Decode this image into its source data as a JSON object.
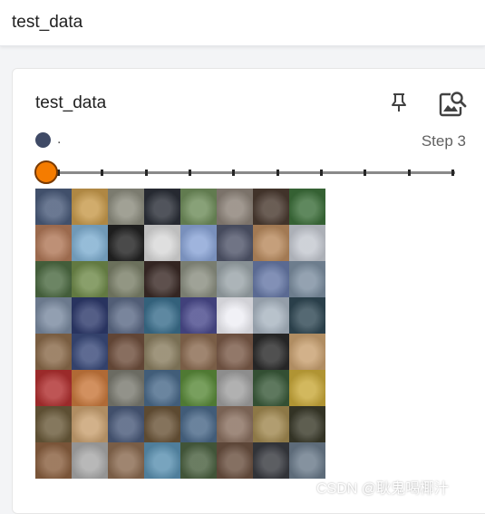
{
  "header": {
    "title": "test_data"
  },
  "card": {
    "title": "test_data",
    "pin_icon": "pin-icon",
    "image_search_icon": "image-search-icon",
    "run_label": ".",
    "run_color": "#3f4a66",
    "step_label": "Step 3",
    "slider": {
      "value": 0,
      "tick_count": 10,
      "accent": "#f57c00"
    },
    "image_grid": {
      "rows": 8,
      "cols": 8,
      "tiles": [
        [
          "#4a5b7a",
          "#c79a4c",
          "#8c8c7e",
          "#2b2f38",
          "#6e8c5a",
          "#8c8278",
          "#4a3a30",
          "#3c6e3a"
        ],
        [
          "#b07858",
          "#7faed0",
          "#222222",
          "#d8d8d8",
          "#8aa4d6",
          "#50556a",
          "#b88a5e",
          "#c4c8d0"
        ],
        [
          "#4c6a42",
          "#6f8a4a",
          "#7a7f68",
          "#3a2a26",
          "#8a8e80",
          "#9aa4a8",
          "#6678a6",
          "#7c8ea0"
        ],
        [
          "#7a8aa0",
          "#2e3a6c",
          "#5c6a86",
          "#3a6e8c",
          "#4a4a8c",
          "#eeeef4",
          "#a8b4c0",
          "#304854"
        ],
        [
          "#8a6a4a",
          "#3a4a7a",
          "#6e4e3c",
          "#8a7e60",
          "#8a6a50",
          "#7a5a48",
          "#2a2a2a",
          "#c8a070"
        ],
        [
          "#b03030",
          "#c8783c",
          "#7a7a70",
          "#4a6a8a",
          "#5a8a3a",
          "#a0a0a0",
          "#3a5a3a",
          "#c8a83a"
        ],
        [
          "#6a5a3a",
          "#c8a070",
          "#4a5a7a",
          "#6a5438",
          "#4a6888",
          "#8a7060",
          "#a08850",
          "#3a3a2a"
        ],
        [
          "#8a6040",
          "#a8a8a8",
          "#8a6a50",
          "#5a90b0",
          "#4a6040",
          "#6a5040",
          "#383a40",
          "#6a7a8a"
        ]
      ]
    }
  },
  "watermark": "CSDN @耿鬼喝椰汁"
}
